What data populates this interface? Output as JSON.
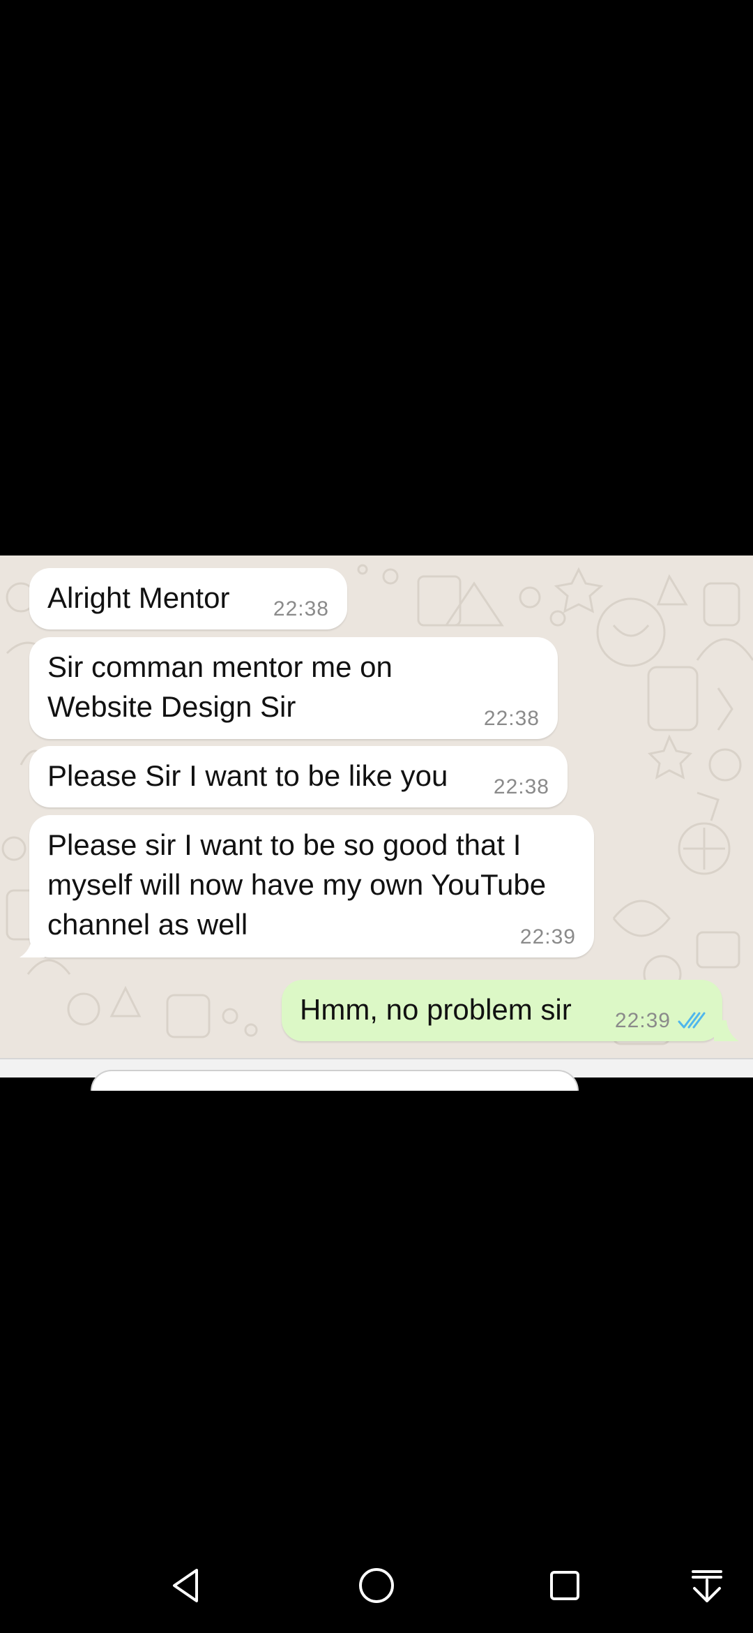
{
  "messages": [
    {
      "direction": "in",
      "text": "Alright Mentor",
      "time": "22:38"
    },
    {
      "direction": "in",
      "text": "Sir comman mentor me on Website Design Sir",
      "time": "22:38"
    },
    {
      "direction": "in",
      "text": "Please Sir I want to be like you",
      "time": "22:38"
    },
    {
      "direction": "in",
      "text": "Please sir I want to be so good that I myself will now have my own YouTube channel as well",
      "time": "22:39"
    },
    {
      "direction": "out",
      "text": "Hmm, no problem sir",
      "time": "22:39",
      "status": "read"
    }
  ],
  "icons": {
    "read_receipt": "double-check-icon",
    "nav_back": "back-triangle-icon",
    "nav_home": "home-circle-icon",
    "nav_recents": "recents-square-icon",
    "nav_notifications": "pull-down-notifications-icon"
  },
  "colors": {
    "incoming_bubble": "#ffffff",
    "outgoing_bubble": "#dcf8c6",
    "chat_background": "#ebe5de",
    "read_tick": "#4fb6ec"
  }
}
